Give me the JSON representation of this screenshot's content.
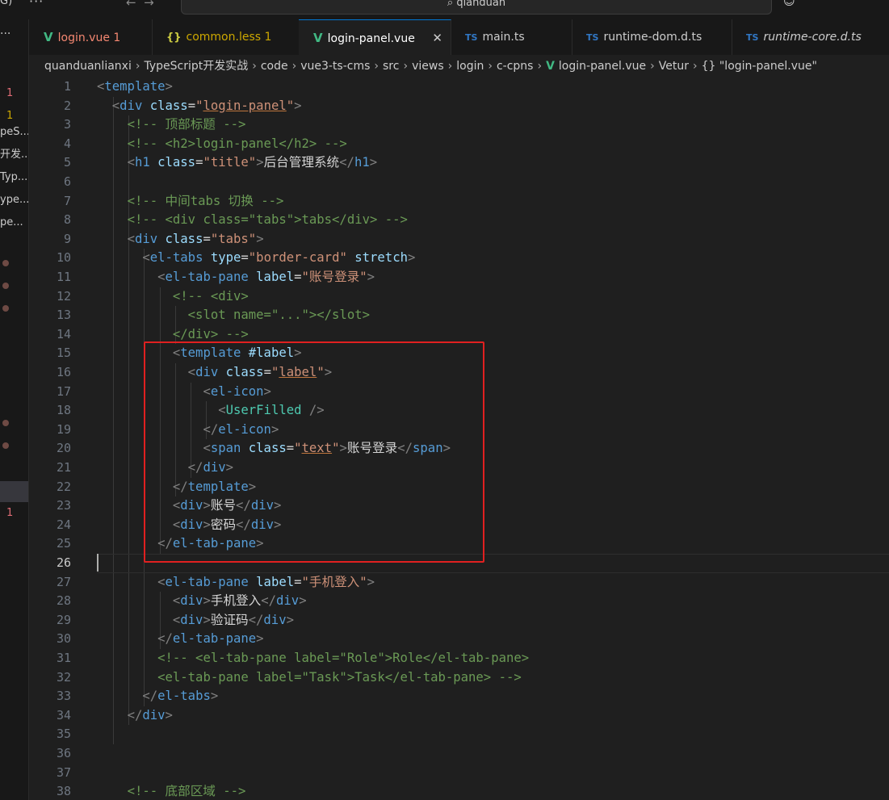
{
  "titlebar": {
    "left_text": "G)",
    "search_text": "qianduan"
  },
  "activity_bar": {
    "rows": [
      {
        "text": "1",
        "color": "#e06c75"
      },
      {
        "text": "1",
        "color": "#cca700"
      },
      {
        "text": "peS...",
        "color": "#cccccc"
      },
      {
        "text": "开发...",
        "color": "#cccccc"
      },
      {
        "text": "Typ...",
        "color": "#cccccc"
      },
      {
        "text": "ype...",
        "color": "#cccccc"
      },
      {
        "text": "pe...",
        "color": "#cccccc"
      },
      {
        "text": "1",
        "color": "#e06c75"
      }
    ]
  },
  "tabs": [
    {
      "label": "login.vue",
      "badge": "1",
      "icon": "vue-icon",
      "color": "#f48771",
      "active": false
    },
    {
      "label": "common.less",
      "badge": "1",
      "icon": "braces-icon",
      "color": "#cca700",
      "active": false
    },
    {
      "label": "login-panel.vue",
      "badge": "",
      "icon": "vue-icon",
      "color": "#ffffff",
      "active": true
    },
    {
      "label": "main.ts",
      "badge": "",
      "icon": "ts-icon",
      "color": "#cccccc",
      "active": false
    },
    {
      "label": "runtime-dom.d.ts",
      "badge": "",
      "icon": "ts-icon",
      "color": "#cccccc",
      "active": false
    },
    {
      "label": "runtime-core.d.ts",
      "badge": "",
      "icon": "ts-icon",
      "color": "#cccccc",
      "active": false
    }
  ],
  "breadcrumb": [
    "quanduanlianxi",
    "TypeScript开发实战",
    "code",
    "vue3-ts-cms",
    "src",
    "views",
    "login",
    "c-cpns",
    "login-panel.vue",
    "Vetur",
    "{} \"login-panel.vue\""
  ],
  "editor": {
    "current_line": 26,
    "lines": [
      {
        "n": "1",
        "t": "<template>"
      },
      {
        "n": "2",
        "t": "  <div class=\"login-panel\">"
      },
      {
        "n": "3",
        "t": "    <!-- 顶部标题 -->"
      },
      {
        "n": "4",
        "t": "    <!-- <h2>login-panel</h2> -->"
      },
      {
        "n": "5",
        "t": "    <h1 class=\"title\">后台管理系统</h1>"
      },
      {
        "n": "6",
        "t": ""
      },
      {
        "n": "7",
        "t": "    <!-- 中间tabs 切换 -->"
      },
      {
        "n": "8",
        "t": "    <!-- <div class=\"tabs\">tabs</div> -->"
      },
      {
        "n": "9",
        "t": "    <div class=\"tabs\">"
      },
      {
        "n": "10",
        "t": "      <el-tabs type=\"border-card\" stretch>"
      },
      {
        "n": "11",
        "t": "        <el-tab-pane label=\"账号登录\">"
      },
      {
        "n": "12",
        "t": "          <!-- <div>"
      },
      {
        "n": "13",
        "t": "            <slot name=\"...\"></slot>"
      },
      {
        "n": "14",
        "t": "          </div> -->"
      },
      {
        "n": "15",
        "t": "          <template #label>"
      },
      {
        "n": "16",
        "t": "            <div class=\"label\">"
      },
      {
        "n": "17",
        "t": "              <el-icon>"
      },
      {
        "n": "18",
        "t": "                <UserFilled />"
      },
      {
        "n": "19",
        "t": "              </el-icon>"
      },
      {
        "n": "20",
        "t": "              <span class=\"text\">账号登录</span>"
      },
      {
        "n": "21",
        "t": "            </div>"
      },
      {
        "n": "22",
        "t": "          </template>"
      },
      {
        "n": "23",
        "t": "          <div>账号</div>"
      },
      {
        "n": "24",
        "t": "          <div>密码</div>"
      },
      {
        "n": "25",
        "t": "        </el-tab-pane>"
      },
      {
        "n": "26",
        "t": ""
      },
      {
        "n": "27",
        "t": "        <el-tab-pane label=\"手机登入\">"
      },
      {
        "n": "28",
        "t": "          <div>手机登入</div>"
      },
      {
        "n": "29",
        "t": "          <div>验证码</div>"
      },
      {
        "n": "30",
        "t": "        </el-tab-pane>"
      },
      {
        "n": "31",
        "t": "        <!-- <el-tab-pane label=\"Role\">Role</el-tab-pane>"
      },
      {
        "n": "32",
        "t": "        <el-tab-pane label=\"Task\">Task</el-tab-pane> -->"
      },
      {
        "n": "33",
        "t": "      </el-tabs>"
      },
      {
        "n": "34",
        "t": "    </div>"
      },
      {
        "n": "35",
        "t": ""
      },
      {
        "n": "36",
        "t": ""
      },
      {
        "n": "37",
        "t": ""
      },
      {
        "n": "38",
        "t": "    <!-- 底部区域 -->"
      }
    ]
  },
  "colors": {
    "tag": "#569cd6",
    "attr": "#9cdcfe",
    "string": "#ce9178",
    "text": "#d4d4d4",
    "comment": "#6a9955",
    "component": "#4ec9b0",
    "highlight_box": "#e02020"
  }
}
